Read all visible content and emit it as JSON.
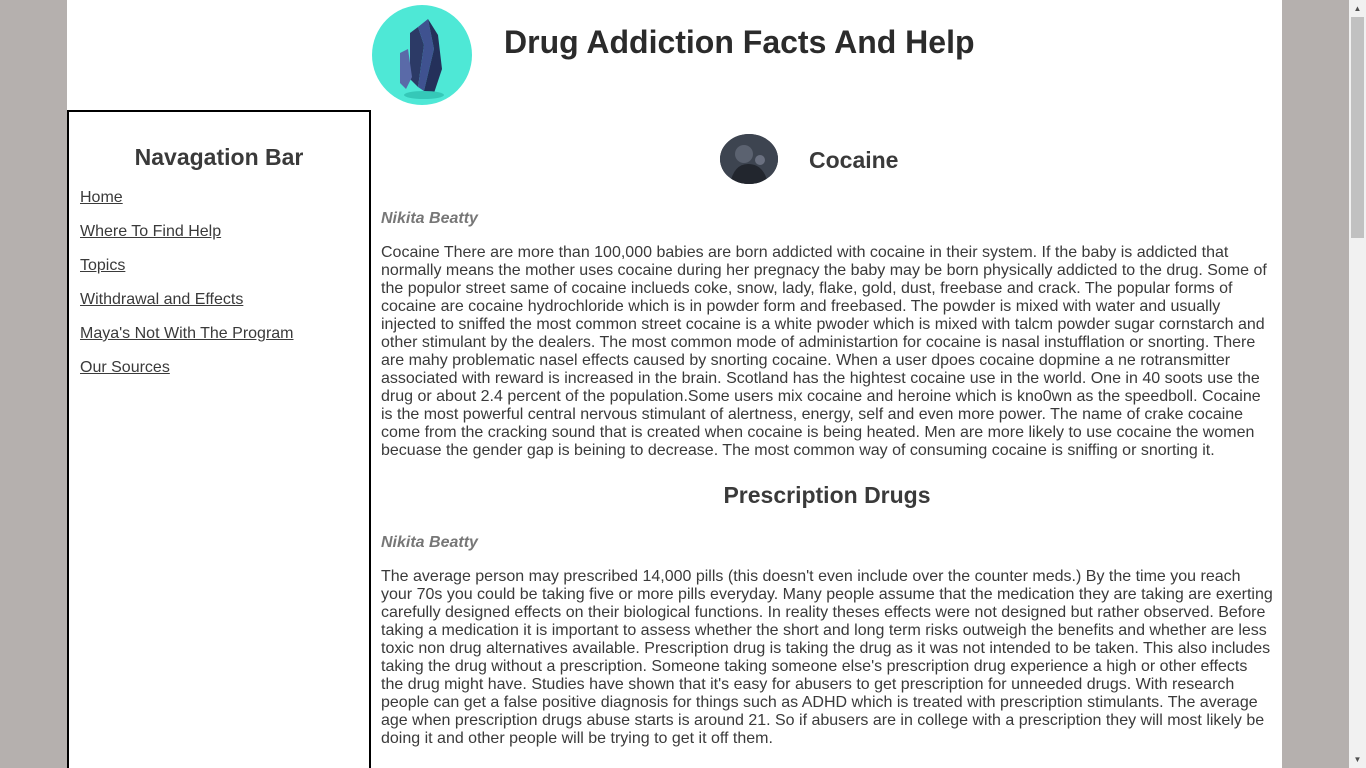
{
  "site": {
    "title": "Drug Addiction Facts And Help",
    "logo_icon": "crystal-icon",
    "logo_bg": "#4ee8d6"
  },
  "nav": {
    "heading": "Navagation Bar",
    "items": [
      {
        "label": "Home"
      },
      {
        "label": "Where To Find Help"
      },
      {
        "label": "Topics"
      },
      {
        "label": "Withdrawal and Effects"
      },
      {
        "label": "Maya's Not With The Program"
      },
      {
        "label": "Our Sources"
      }
    ]
  },
  "sections": [
    {
      "title": "Cocaine",
      "author": "Nikita Beatty",
      "body": "Cocaine There are more than 100,000 babies are born addicted with cocaine in their system. If the baby is addicted that normally means the mother uses cocaine during her pregnacy the baby may be born physically addicted to the drug. Some of the populor street same of cocaine inclueds coke, snow, lady, flake, gold, dust, freebase and crack. The popular forms of cocaine are cocaine hydrochloride which is in powder form and freebased. The powder is mixed with water and usually injected to sniffed the most common street cocaine is a white pwoder which is mixed with talcm powder sugar cornstarch and other stimulant by the dealers. The most common mode of administartion for cocaine is nasal instufflation or snorting. There are mahy problematic nasel effects caused by snorting cocaine. When a user dpoes cocaine dopmine a ne rotransmitter associated with reward is increased in the brain. Scotland has the hightest cocaine use in the world. One in 40 soots use the drug or about 2.4 percent of the population.Some users mix cocaine and heroine which is kno0wn as the speedboll. Cocaine is the most powerful central nervous stimulant of alertness, energy, self and even more power. The name of crake cocaine come from the cracking sound that is created when cocaine is being heated. Men are more likely to use cocaine the women becuase the gender gap is beining to decrease. The most common way of consuming cocaine is sniffing or snorting it."
    },
    {
      "title": "Prescription Drugs",
      "author": "Nikita Beatty",
      "body": "The average person may prescribed 14,000 pills (this doesn't even include over the counter meds.) By the time you reach your 70s you could be taking five or more pills everyday. Many people assume that the medication they are taking are exerting carefully designed effects on their biological functions. In reality theses effects were not designed but rather observed. Before taking a medication it is important to assess whether the short and long term risks outweigh the benefits and whether are less toxic non drug alternatives available. Prescription drug is taking the drug as it was not intended to be taken. This also includes taking the drug without a prescription. Someone taking someone else's prescription drug experience a high or other effects the drug might have. Studies have shown that it's easy for abusers to get prescription for unneeded drugs. With research people can get a false positive diagnosis for things such as ADHD which is treated with prescription stimulants. The average age when prescription drugs abuse starts is around 21. So if abusers are in college with a prescription they will most likely be doing it and other people will be trying to get it off them."
    }
  ]
}
